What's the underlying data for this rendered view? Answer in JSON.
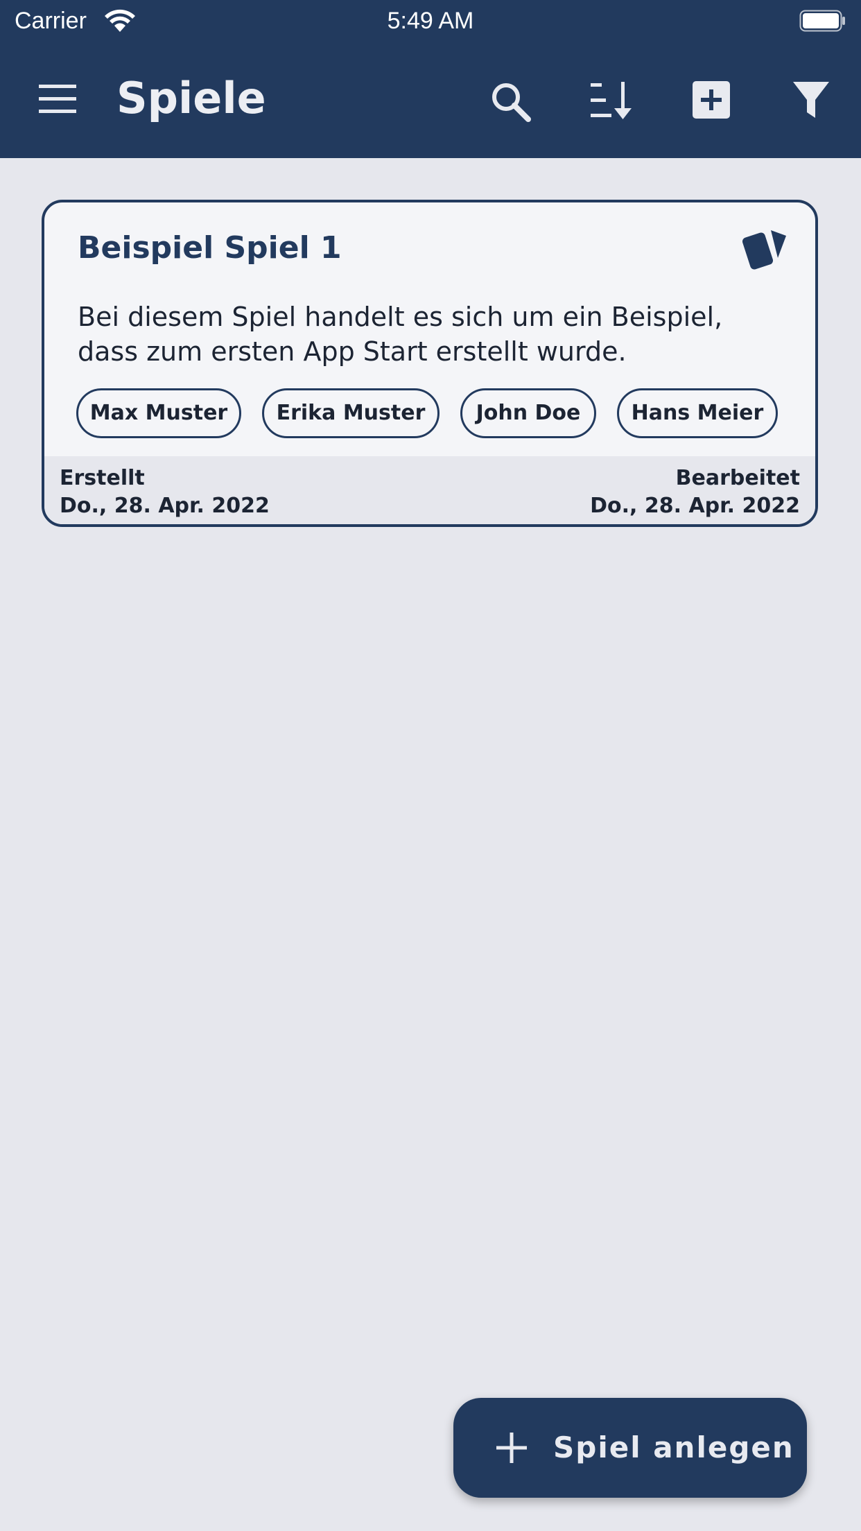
{
  "status_bar": {
    "carrier": "Carrier",
    "time": "5:49 AM"
  },
  "app_bar": {
    "title": "Spiele",
    "icons": [
      "menu-icon",
      "search-icon",
      "sort-icon",
      "add-box-icon",
      "filter-icon"
    ]
  },
  "games": [
    {
      "title": "Beispiel Spiel 1",
      "type_icon": "cards-icon",
      "description": "Bei diesem Spiel handelt es sich um ein Beispiel, dass zum ersten App Start erstellt wurde.",
      "players": [
        "Max Muster",
        "Erika Muster",
        "John Doe",
        "Hans Meier"
      ],
      "created_label": "Erstellt",
      "created_date": "Do., 28. Apr. 2022",
      "edited_label": "Bearbeitet",
      "edited_date": "Do., 28. Apr. 2022"
    }
  ],
  "fab": {
    "label": "Spiel anlegen",
    "icon": "plus-icon"
  },
  "colors": {
    "primary": "#223a5e",
    "background": "#e6e7ed",
    "card": "#f4f5f8",
    "on_primary": "#e8eaf0"
  }
}
